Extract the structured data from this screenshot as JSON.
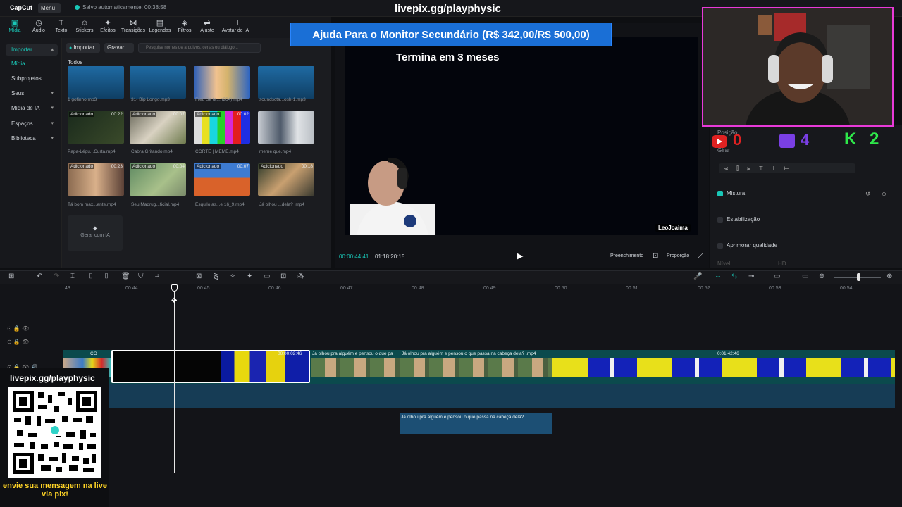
{
  "app": {
    "logo": "CapCut",
    "menu_label": "Menu",
    "autosave": "Salvo automaticamente: 00:38:58"
  },
  "overlay": {
    "livepix_top": "livepix.gg/playphysic",
    "donation_banner": "Ajuda Para o Monitor Secundário (R$ 342,00/R$ 500,00)",
    "donation_sub": "Termina em 3 meses",
    "watermark": "LeoJoaima",
    "livepix_side": "livepix.gg/playphysic",
    "livepix_msg": "envie sua mensagem na live via pix!",
    "score": {
      "youtube": "0",
      "twitch": "4",
      "k": "K 2"
    }
  },
  "tools": [
    {
      "label": "Mídia",
      "icon": "media-icon",
      "glyph": "▣"
    },
    {
      "label": "Áudio",
      "icon": "audio-icon",
      "glyph": "◷"
    },
    {
      "label": "Texto",
      "icon": "text-icon",
      "glyph": "T"
    },
    {
      "label": "Stickers",
      "icon": "stickers-icon",
      "glyph": "☺"
    },
    {
      "label": "Efeitos",
      "icon": "effects-icon",
      "glyph": "✦"
    },
    {
      "label": "Transições",
      "icon": "transitions-icon",
      "glyph": "⋈"
    },
    {
      "label": "Legendas",
      "icon": "captions-icon",
      "glyph": "▤"
    },
    {
      "label": "Filtros",
      "icon": "filters-icon",
      "glyph": "◈"
    },
    {
      "label": "Ajuste",
      "icon": "adjust-icon",
      "glyph": "⇌"
    },
    {
      "label": "Avatar de IA",
      "icon": "ai-avatar-icon",
      "glyph": "☐"
    }
  ],
  "nav": {
    "importar": "Importar",
    "midia": "Mídia",
    "subprojetos": "Subprojetos",
    "seus": "Seus",
    "midia_ia": "Mídia de IA",
    "espacos": "Espaços",
    "biblioteca": "Biblioteca"
  },
  "media": {
    "import_btn": "Importar",
    "record_btn": "Gravar",
    "search_placeholder": "Pesquise nomes de arquivos, cenas ou diálogo...",
    "all_label": "Todos",
    "ai_generate": "Gerar com IA",
    "added": "Adicionado",
    "clips": [
      {
        "name": "1 gofinho.mp3",
        "dur": ""
      },
      {
        "name": "31- Bip Longo.mp3",
        "dur": ""
      },
      {
        "name": "Fred Se ta...h264).mp4",
        "dur": ""
      },
      {
        "name": "soundscta...osh-1.mp3",
        "dur": ""
      },
      {
        "name": "Papa-Légu...Curta.mp4",
        "dur": "00:22"
      },
      {
        "name": "Cabra Gritando.mp4",
        "dur": "00:07"
      },
      {
        "name": "CORTE | MEME.mp4",
        "dur": "00:02"
      },
      {
        "name": "meme que.mp4",
        "dur": ""
      },
      {
        "name": "Tá bom max...ente.mp4",
        "dur": "00:23"
      },
      {
        "name": "Seu Madrug...ficial.mp4",
        "dur": "00:04"
      },
      {
        "name": "Esquilo as...e 16_9.mp4",
        "dur": "00:07"
      },
      {
        "name": "Já olhou ...dela? .mp4",
        "dur": "00:18"
      }
    ]
  },
  "player": {
    "time_current": "00:00:44:41",
    "time_total": "01:18:20:15",
    "fill_btn": "Preenchimento",
    "ratio_btn": "Proporção"
  },
  "inspector": {
    "position": "Posição",
    "rotate": "Girar",
    "blend": "Mistura",
    "stabilize": "Estabilização",
    "enhance": "Aprimorar qualidade",
    "level": "Nível",
    "hd": "HD"
  },
  "timeline": {
    "ticks": [
      "00:44",
      "00:45",
      "00:46",
      "00:47",
      "00:48",
      "00:49",
      "00:50",
      "00:51",
      "00:52",
      "00:53",
      "00:54"
    ],
    "clip_selected_time": "00:00:02:46",
    "clip_meme": "Já olhou pra alguém e pensou o que pa",
    "clip_meme2": "Já olhou pra alguém e pensou o que passa na cabeça dela? .mp4",
    "clip_long_time": "0:01:42:46",
    "subtitle_clip": "Já olhou pra alguém e pensou o que passa na cabeça dela?"
  }
}
